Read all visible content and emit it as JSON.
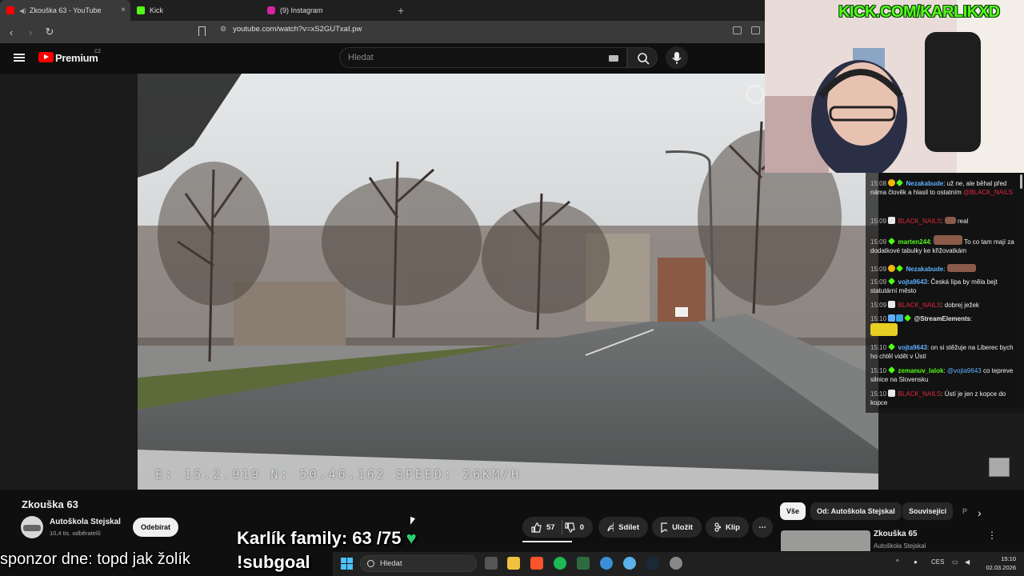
{
  "browser": {
    "tabs": [
      {
        "label": "Zkouška 63 - YouTube",
        "active": true
      },
      {
        "label": "Kick",
        "active": false
      },
      {
        "label": "(9) Instagram",
        "active": false
      }
    ],
    "new_tab": "+",
    "close": "×",
    "url": "youtube.com/watch?v=xS2GUTxaI.pw"
  },
  "youtube": {
    "brand": "Premium",
    "region": "CZ",
    "search_placeholder": "Hledat",
    "video": {
      "title": "Zkouška 63",
      "gps_overlay": "E: 15.2.919  N: 50.46.162  SPEED: 26KM/H"
    },
    "channel": {
      "name": "Autoškola Stejskal",
      "subscribers": "10,4 tis. odběratelů",
      "subscribe_label": "Odebírat"
    },
    "actions": {
      "likes": "57",
      "dislikes": "0",
      "share": "Sdílet",
      "save": "Uložit",
      "clip": "Klip",
      "more": "⋯"
    },
    "chips": [
      "Vše",
      "Od: Autoškola Stejskal",
      "Související",
      "P"
    ],
    "recommendation": {
      "title": "Zkouška 65",
      "channel": "Autoškola Stejskal"
    }
  },
  "stream": {
    "kick_link": "KICK.COM/KARLIKXD",
    "family_goal": "Karlík family: 63 /75",
    "subgoal": "!subgoal",
    "sponsor": "sponzor dne: topd jak žolík"
  },
  "chat": [
    {
      "time": "15:08",
      "user": "Nezakabude",
      "user_color": "#5fb0ff",
      "text": "už ne, ale běhal před náma člověk a hlasil to ostatním",
      "mention": "@BLACK_NAILS"
    },
    {
      "time": "15:09",
      "user": "BLACK_NAILS",
      "user_color": "#e0283a",
      "text": "real"
    },
    {
      "time": "15:09",
      "user": "marten244",
      "user_color": "#53fc18",
      "text": "To co tam mají za dodatkové tabulky ke křižovatkám"
    },
    {
      "time": "15:09",
      "user": "Nezakabude",
      "user_color": "#5fb0ff",
      "text": ""
    },
    {
      "time": "15:09",
      "user": "vojta9643",
      "user_color": "#5fb0ff",
      "text": "Česká lípa by měla bejt statutární město"
    },
    {
      "time": "15:09",
      "user": "BLACK_NAILS",
      "user_color": "#e0283a",
      "text": "dobrej ježek"
    },
    {
      "time": "15:10",
      "user": "@StreamElements",
      "user_color": "#e6e6e6",
      "text": ""
    },
    {
      "time": "15:10",
      "user": "vojta9643",
      "user_color": "#5fb0ff",
      "text": "on si stěžuje na Liberec bych ho chtěl vidět v Ústí"
    },
    {
      "time": "15:10",
      "user": "zemanuv_lalok",
      "user_color": "#53fc18",
      "text": "co tepreve silnice na Slovensku",
      "mention_inline": "@vojta9643"
    },
    {
      "time": "15:10",
      "user": "BLACK_NAILS",
      "user_color": "#e0283a",
      "text": "Ústí je jen z kopce do kopce"
    }
  ],
  "taskbar": {
    "search_placeholder": "Hledat",
    "lang": "CES",
    "time": "15:10",
    "date": "02.03.2026"
  },
  "colors": {
    "kick_green": "#53fc18",
    "youtube_red": "#ff0000",
    "heart": "#2ecc71"
  }
}
